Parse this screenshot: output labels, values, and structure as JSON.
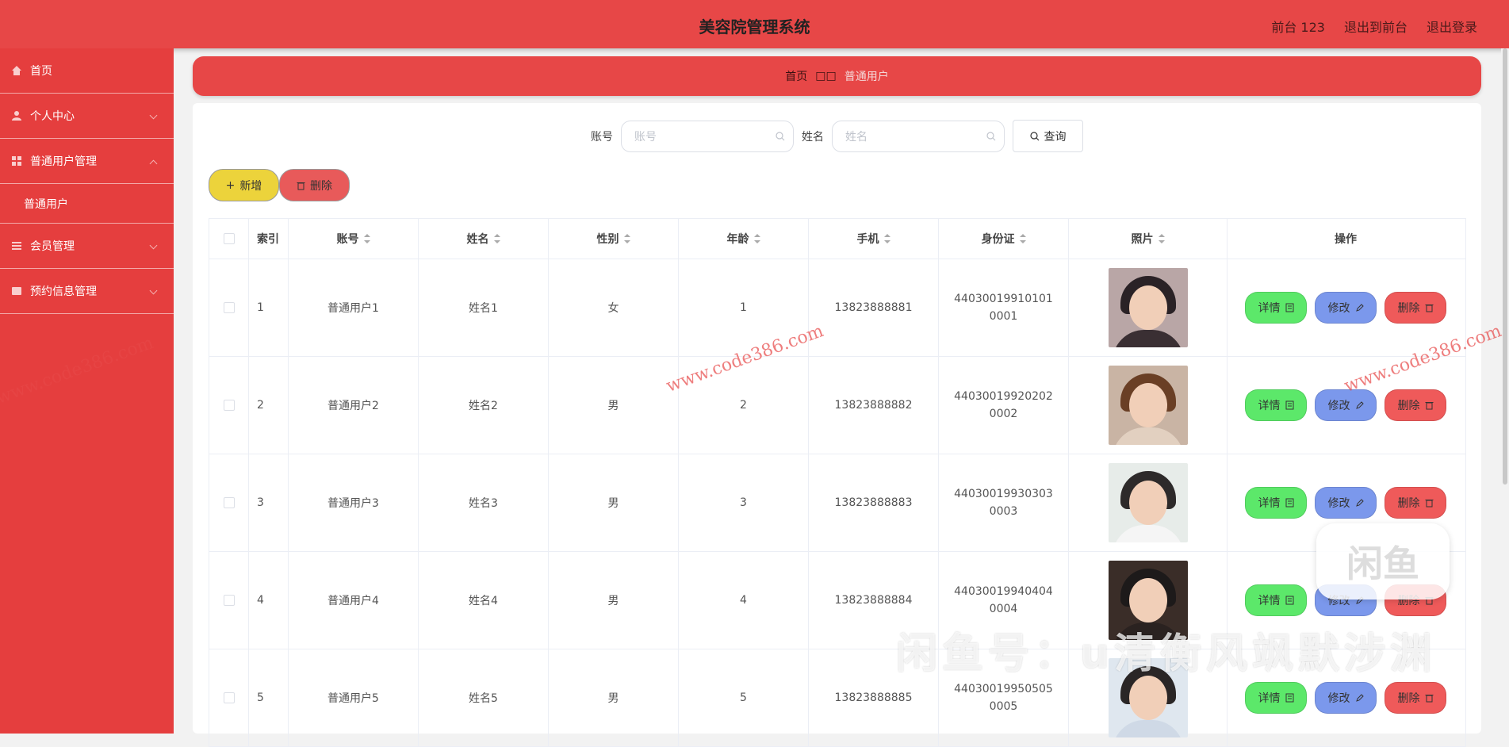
{
  "header": {
    "title": "美容院管理系统",
    "links": [
      "前台 123",
      "退出到前台",
      "退出登录"
    ]
  },
  "sidebar": {
    "items": [
      {
        "label": "首页",
        "icon": "home-icon"
      },
      {
        "label": "个人中心",
        "icon": "user-icon"
      },
      {
        "label": "普通用户管理",
        "icon": "grid-icon"
      },
      {
        "label": "普通用户",
        "icon": ""
      },
      {
        "label": "会员管理",
        "icon": "list-icon"
      },
      {
        "label": "预约信息管理",
        "icon": "card-icon"
      }
    ]
  },
  "breadcrumb": {
    "home": "首页",
    "sep": "□□",
    "current": "普通用户"
  },
  "search": {
    "account_label": "账号",
    "account_placeholder": "账号",
    "name_label": "姓名",
    "name_placeholder": "姓名",
    "query_label": "查询"
  },
  "actions": {
    "add_label": "新增",
    "delete_label": "删除"
  },
  "table": {
    "headers": [
      "索引",
      "账号",
      "姓名",
      "性别",
      "年龄",
      "手机",
      "身份证",
      "照片",
      "操作"
    ],
    "rows": [
      {
        "index": "1",
        "account": "普通用户1",
        "name": "姓名1",
        "gender": "女",
        "age": "1",
        "phone": "13823888881",
        "idcard": "440300199101010001"
      },
      {
        "index": "2",
        "account": "普通用户2",
        "name": "姓名2",
        "gender": "男",
        "age": "2",
        "phone": "13823888882",
        "idcard": "440300199202020002"
      },
      {
        "index": "3",
        "account": "普通用户3",
        "name": "姓名3",
        "gender": "男",
        "age": "3",
        "phone": "13823888883",
        "idcard": "440300199303030003"
      },
      {
        "index": "4",
        "account": "普通用户4",
        "name": "姓名4",
        "gender": "男",
        "age": "4",
        "phone": "13823888884",
        "idcard": "440300199404040004"
      },
      {
        "index": "5",
        "account": "普通用户5",
        "name": "姓名5",
        "gender": "男",
        "age": "5",
        "phone": "13823888885",
        "idcard": "440300199505050005"
      }
    ],
    "op_labels": {
      "detail": "详情",
      "edit": "修改",
      "remove": "删除"
    }
  },
  "watermarks": {
    "site": "www.code386.com",
    "xianyu": "闲鱼号：",
    "xianyu_name": "u清衡风飒默涉渊",
    "xianyu_logo": "闲鱼"
  },
  "colors": {
    "primary": "#e74747",
    "sidebar": "#e53e3e",
    "detail": "#5ce86a",
    "edit": "#7b98ec",
    "remove": "#ef5a5a",
    "add": "#ecd33b"
  }
}
